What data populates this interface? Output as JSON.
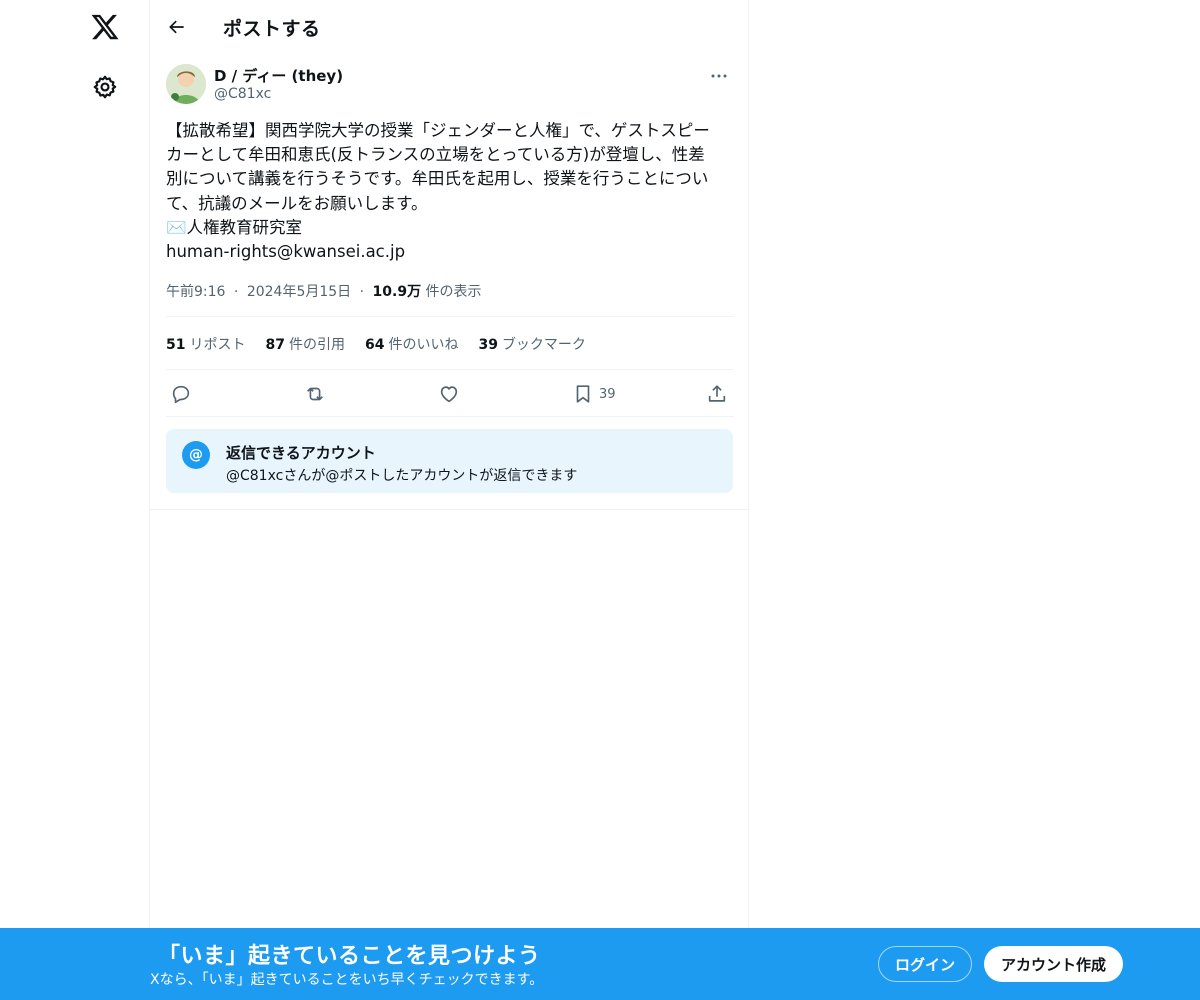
{
  "nav": {
    "logo_icon": "x-logo-icon",
    "settings_icon": "gear-icon"
  },
  "header": {
    "title": "ポストする",
    "back_icon": "arrow-left-icon"
  },
  "post": {
    "author_name": "D / ディー (they)",
    "author_handle": "@C81xc",
    "text_lines": [
      "【拡散希望】関西学院大学の授業「ジェンダーと人権」で、ゲストスピー",
      "カーとして牟田和恵氏(反トランスの立場をとっている方)が登壇し、性差",
      "別について講義を行うそうです。牟田氏を起用し、授業を行うことについ",
      "て、抗議のメールをお願いします。",
      "✉️人権教育研究室",
      "human-rights@kwansei.ac.jp"
    ],
    "time": "午前9:16",
    "date": "2024年5月15日",
    "views_count": "10.9万",
    "views_label": "件の表示",
    "separator": "·"
  },
  "stats": {
    "reposts_count": "51",
    "reposts_label": "リポスト",
    "quotes_count": "87",
    "quotes_label": "件の引用",
    "likes_count": "64",
    "likes_label": "件のいいね",
    "bookmarks_count": "39",
    "bookmarks_label": "ブックマーク"
  },
  "actions": {
    "bookmark_count": "39"
  },
  "reply_restriction": {
    "icon_char": "@",
    "title": "返信できるアカウント",
    "description": "@C81xcさんが@ポストしたアカウントが返信できます"
  },
  "banner": {
    "title": "「いま」起きていることを見つけよう",
    "subtitle": "Xなら、「いま」起きていることをいち早くチェックできます。",
    "login_label": "ログイン",
    "signup_label": "アカウント作成"
  },
  "colors": {
    "accent": "#1d9bf0",
    "text_primary": "#0f1419",
    "text_secondary": "#536471",
    "reply_box_bg": "#e8f5fd"
  }
}
